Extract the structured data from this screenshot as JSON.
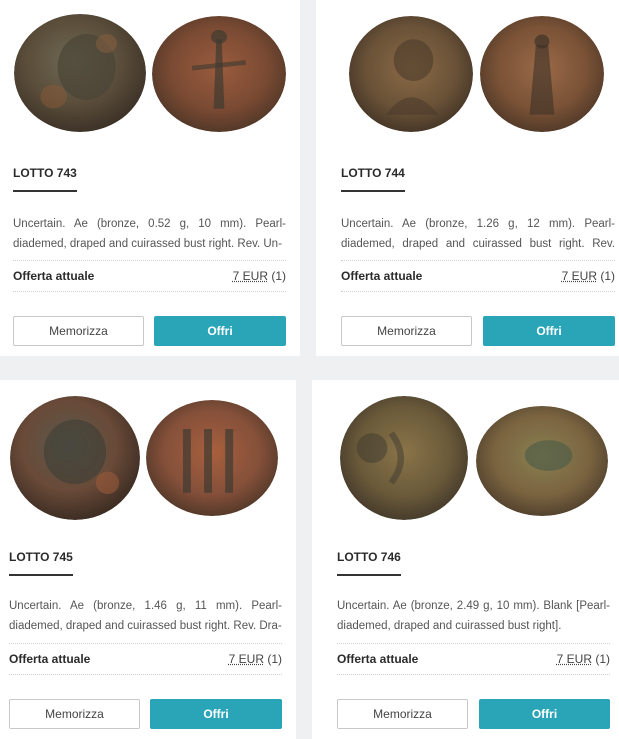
{
  "lots": [
    {
      "title": "LOTTO 743",
      "description": "Uncertain. Ae (bronze, 0.52 g, 10 mm). Pearl-diademed, draped and cuirassed bust right. Rev. Un-",
      "offer_label": "Offerta attuale",
      "price": "7 EUR",
      "bids": "(1)",
      "save_label": "Memorizza",
      "bid_label": "Offri",
      "obverse_image": "coin-obverse-image",
      "reverse_image": "coin-reverse-image"
    },
    {
      "title": "LOTTO 744",
      "description": "Uncertain. Ae (bronze, 1.26 g, 12 mm). Pearl-diademed, draped and cuirassed bust right. Rev. [VIC-",
      "offer_label": "Offerta attuale",
      "price": "7 EUR",
      "bids": "(1)",
      "save_label": "Memorizza",
      "bid_label": "Offri",
      "obverse_image": "coin-obverse-image",
      "reverse_image": "coin-reverse-image"
    },
    {
      "title": "LOTTO 745",
      "description": "Uncertain. Ae (bronze, 1.46 g, 11 mm). Pearl-diademed, draped and cuirassed bust right. Rev. Dra-",
      "offer_label": "Offerta attuale",
      "price": "7 EUR",
      "bids": "(1)",
      "save_label": "Memorizza",
      "bid_label": "Offri",
      "obverse_image": "coin-obverse-image",
      "reverse_image": "coin-reverse-image"
    },
    {
      "title": "LOTTO 746",
      "description": "Uncertain. Ae (bronze, 2.49 g, 10 mm). Blank [Pearl-diademed, draped and cuirassed bust right].",
      "offer_label": "Offerta attuale",
      "price": "7 EUR",
      "bids": "(1)",
      "save_label": "Memorizza",
      "bid_label": "Offri",
      "obverse_image": "coin-obverse-image",
      "reverse_image": "coin-reverse-image"
    }
  ],
  "colors": {
    "accent": "#2aa5b8",
    "background": "#eef0f2",
    "coin_bronze": "#7a5a3e",
    "coin_patina": "#4f5a45"
  }
}
